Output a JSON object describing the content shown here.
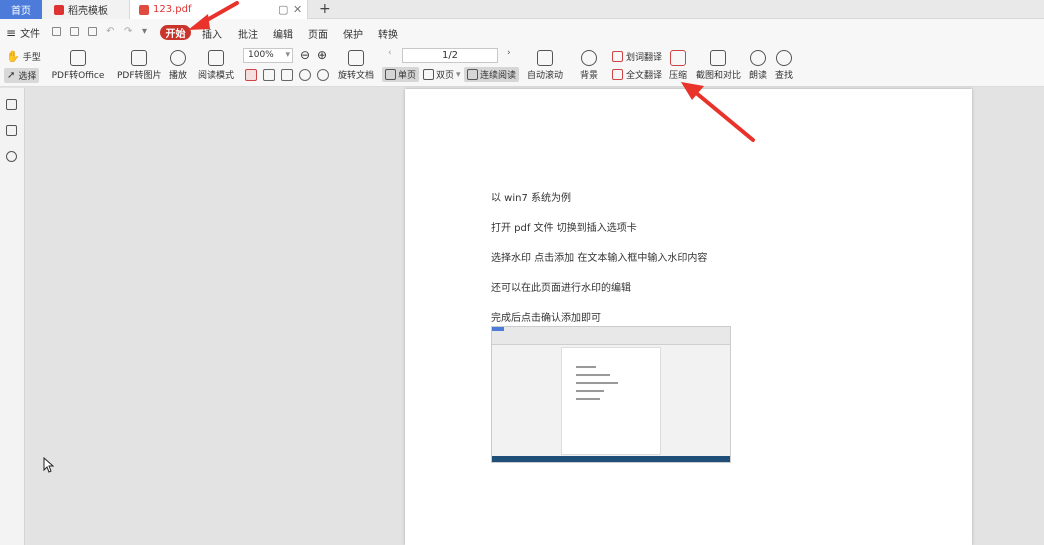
{
  "tabs": {
    "home": "首页",
    "template": "稻壳模板",
    "file": "123.pdf",
    "new_tab": "+"
  },
  "menu": {
    "file": "文件",
    "start": "开始",
    "insert": "插入",
    "annotate": "批注",
    "edit": "编辑",
    "page": "页面",
    "protect": "保护",
    "convert": "转换"
  },
  "toolbar": {
    "hand": "手型",
    "select": "选择",
    "pdf_to_office": "PDF转Office",
    "pdf_to_image": "PDF转图片",
    "play": "播放",
    "reading_mode": "阅读模式",
    "zoom": "100%",
    "page_indicator": "1/2",
    "rotate": "旋转文档",
    "single_page": "单页",
    "double_page": "双页",
    "continuous": "连续阅读",
    "auto_scroll": "自动滚动",
    "background": "背景",
    "word_translate": "划词翻译",
    "full_translate": "全文翻译",
    "compress": "压缩",
    "screenshot_compare": "截图和对比",
    "read_aloud": "朗读",
    "find": "查找"
  },
  "document": {
    "lines": [
      "以 win7 系统为例",
      "打开 pdf 文件   切换到插入选项卡",
      "选择水印     点击添加    在文本输入框中输入水印内容",
      "还可以在此页面进行水印的编辑",
      "完成后点击确认添加即可"
    ]
  },
  "colors": {
    "accent": "#4c7bd9",
    "start_tab": "#c9352b",
    "annotation_arrow": "#e8322a"
  }
}
